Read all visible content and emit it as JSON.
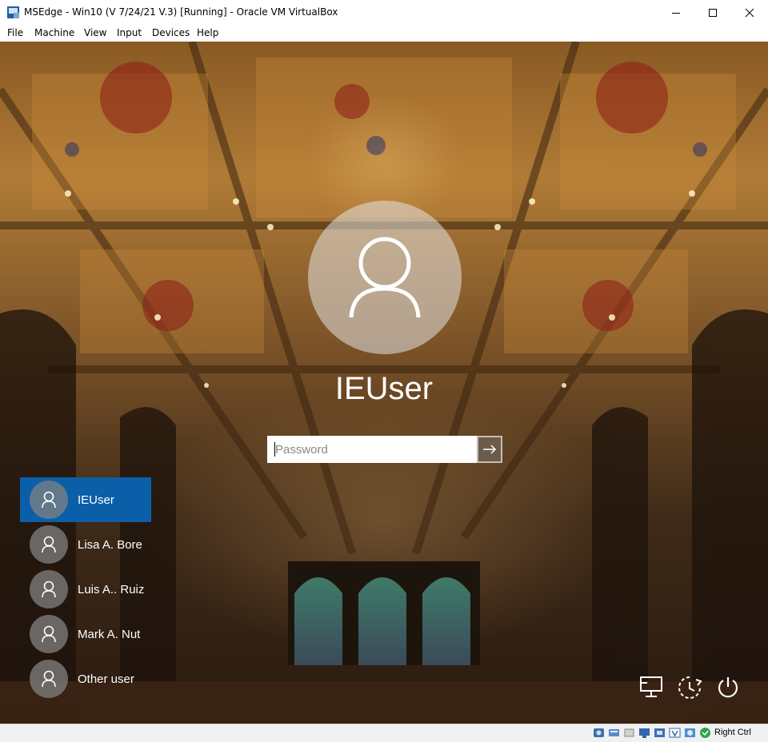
{
  "window": {
    "title": "MSEdge - Win10 (V 7/24/21 V.3) [Running] - Oracle VM VirtualBox"
  },
  "menu": {
    "items": [
      "File",
      "Machine",
      "View",
      "Input",
      "Devices",
      "Help"
    ]
  },
  "login": {
    "username": "IEUser",
    "password_placeholder": "Password",
    "users": [
      {
        "name": "IEUser",
        "selected": true
      },
      {
        "name": "Lisa A. Bore",
        "selected": false
      },
      {
        "name": "Luis A.. Ruiz",
        "selected": false
      },
      {
        "name": "Mark A. Nut",
        "selected": false
      },
      {
        "name": "Other user",
        "selected": false
      }
    ],
    "tray_icons": [
      "network-icon",
      "ease-of-access-icon",
      "power-icon"
    ],
    "accent_color": "#0b5fa9"
  },
  "statusbar": {
    "host_key": "Right Ctrl"
  }
}
